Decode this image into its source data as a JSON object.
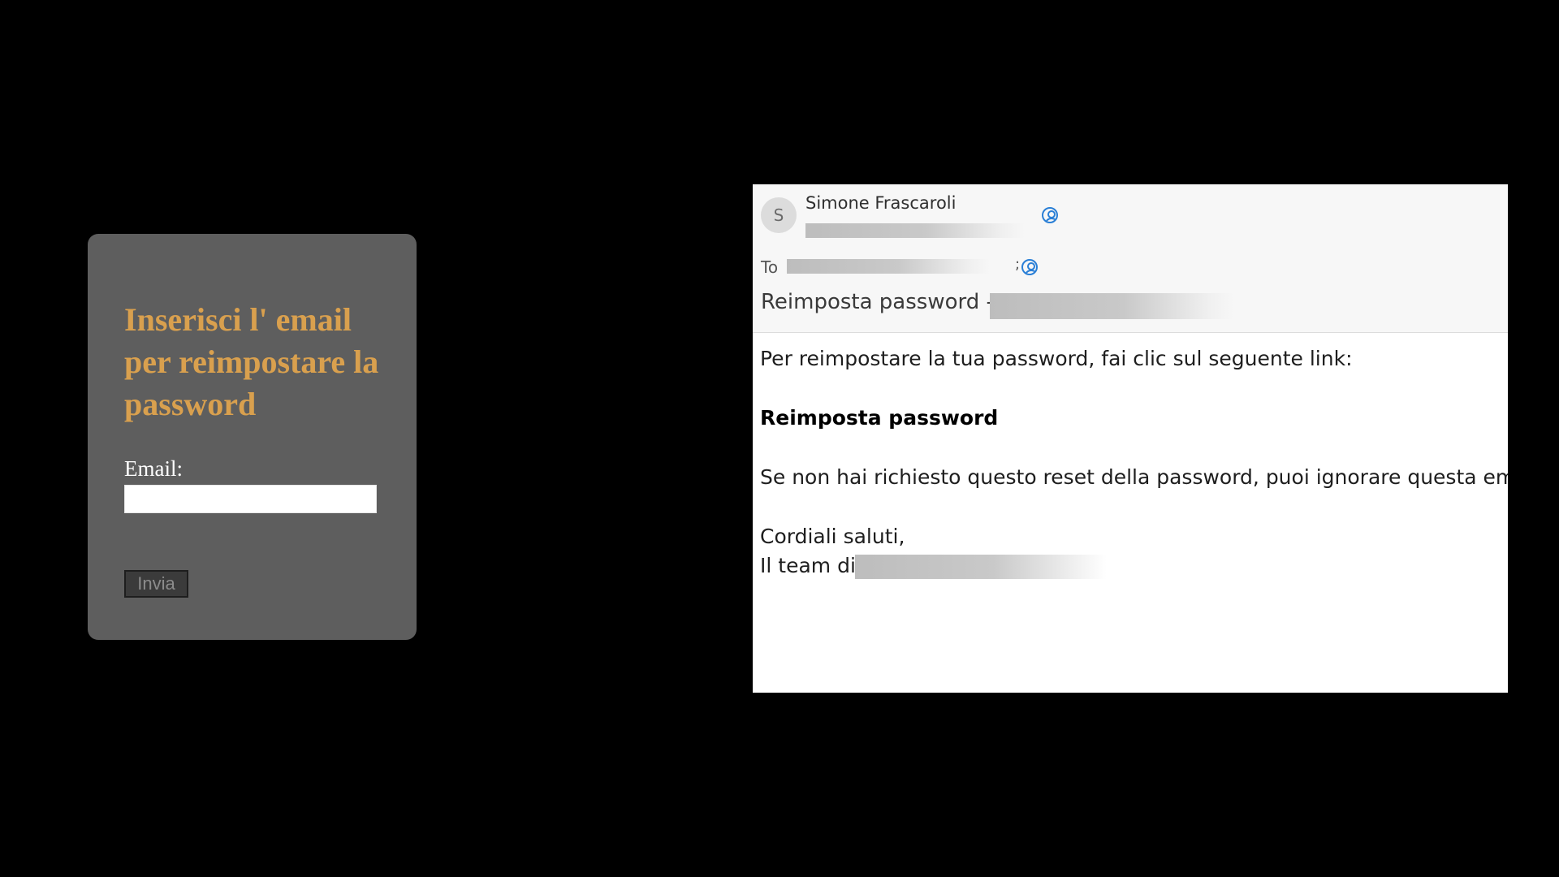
{
  "reset_form": {
    "title": "Inserisci l' email per reimpostare la password",
    "email_label": "Email:",
    "email_value": "",
    "submit_label": "Invia"
  },
  "email": {
    "avatar_initial": "S",
    "sender_name": "Simone Frascaroli",
    "to_label": "To",
    "recipient_separator": ";",
    "subject": "Reimposta password -",
    "body": {
      "intro": "Per reimpostare la tua password, fai clic sul seguente link:",
      "link_text": "Reimposta password",
      "ignore_note": "Se non hai richiesto questo reset della password, puoi ignorare questa email.",
      "regards": "Cordiali saluti,",
      "team_prefix": "Il team di"
    }
  },
  "colors": {
    "page_background": "#000000",
    "form_card": "#5e5e5e",
    "form_title": "#d9a04e",
    "contact_icon": "#2a7fd6"
  },
  "icons": {
    "contact": "contact-card-icon"
  }
}
